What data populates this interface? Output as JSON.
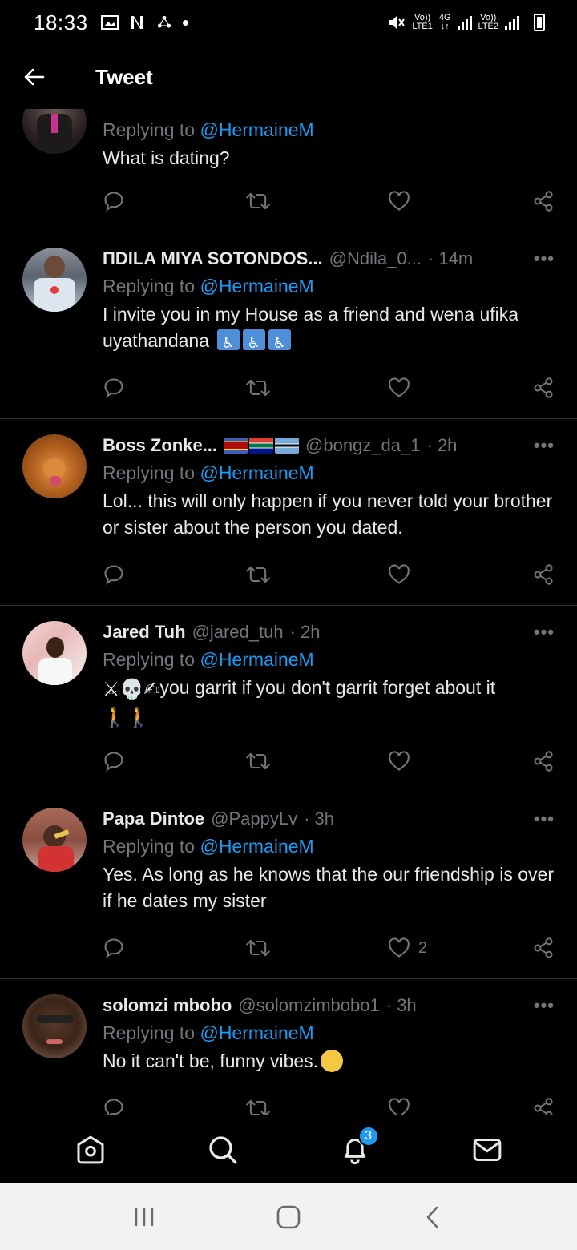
{
  "status_bar": {
    "time": "18:33",
    "sim1_label": "LTE1",
    "sim2_label": "LTE2",
    "net_label": "4G",
    "volte": "Vo))"
  },
  "header": {
    "title": "Tweet"
  },
  "colors": {
    "accent": "#1d9bf0",
    "muted": "#71767b",
    "background": "#000000"
  },
  "tweets": [
    {
      "name": "",
      "handle": "",
      "time": "",
      "replying_label": "Replying to",
      "replying_to": "@HermaineM",
      "text": "What is dating?",
      "likes": ""
    },
    {
      "name": "ΠDILA MIYA SOTONDOS...",
      "handle": "@Ndila_0...",
      "time": "· 14m",
      "replying_label": "Replying to",
      "replying_to": "@HermaineM",
      "text": "I invite you in my House as a friend and wena ufika uyathandana",
      "likes": ""
    },
    {
      "name": "Boss Zonke...",
      "handle": "@bongz_da_1",
      "time": "· 2h",
      "replying_label": "Replying to",
      "replying_to": "@HermaineM",
      "text": "Lol... this will only happen if you never told your brother or sister about the person you dated.",
      "likes": ""
    },
    {
      "name": "Jared Tuh",
      "handle": "@jared_tuh",
      "time": "· 2h",
      "replying_label": "Replying to",
      "replying_to": "@HermaineM",
      "text": "you garrit if you don't garrit forget about it",
      "likes": ""
    },
    {
      "name": "Papa Dintoe",
      "handle": "@PappyLv",
      "time": "· 3h",
      "replying_label": "Replying to",
      "replying_to": "@HermaineM",
      "text": "Yes. As long as he knows that the our friendship is over if he dates my sister",
      "likes": "2"
    },
    {
      "name": "solomzi mbobo",
      "handle": "@solomzimbobo1",
      "time": "· 3h",
      "replying_label": "Replying to",
      "replying_to": "@HermaineM",
      "text": "No it can't be, funny vibes.",
      "likes": ""
    }
  ],
  "bottom_nav": {
    "items": [
      "home-icon",
      "search-icon",
      "notifications-icon",
      "messages-icon"
    ],
    "notification_count": "3"
  }
}
